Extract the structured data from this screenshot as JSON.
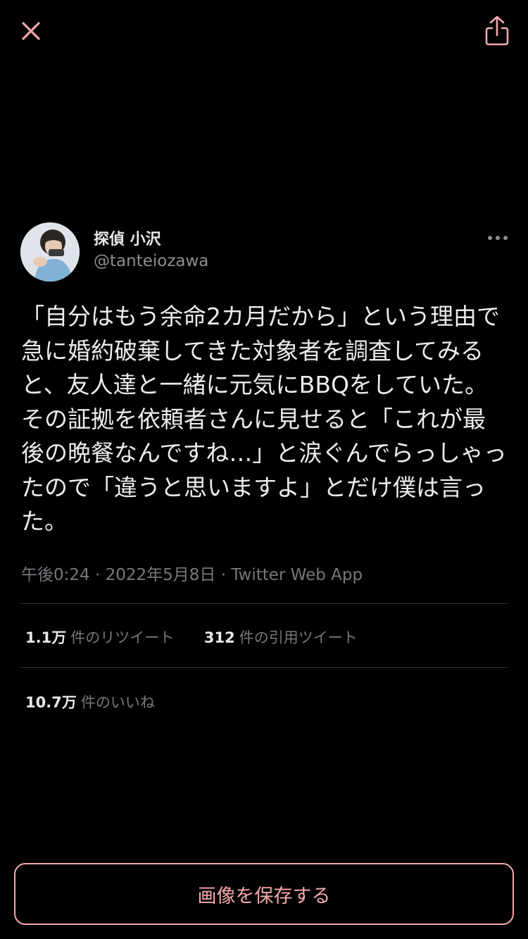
{
  "colors": {
    "background": "#000000",
    "accent": "#f4a7a9",
    "primary_text": "#ececec",
    "secondary_text": "#76787c",
    "divider": "#2e3033"
  },
  "toolbar": {
    "close_icon": "close-icon",
    "share_icon": "share-icon"
  },
  "tweet": {
    "display_name": "探偵 小沢",
    "handle": "@tanteiozawa",
    "more_icon": "more-horizontal-icon",
    "text": "「自分はもう余命2カ月だから」という理由で急に婚約破棄してきた対象者を調査してみると、友人達と一緒に元気にBBQをしていた。その証拠を依頼者さんに見せると「これが最後の晩餐なんですね…」と涙ぐんでらっしゃったので「違うと思いますよ」とだけ僕は言った。",
    "meta": "午後0:24 · 2022年5月8日 · Twitter Web App"
  },
  "stats": {
    "retweets": {
      "count": "1.1万",
      "label": "件のリツイート"
    },
    "quotes": {
      "count": "312",
      "label": "件の引用ツイート"
    },
    "likes": {
      "count": "10.7万",
      "label": "件のいいね"
    }
  },
  "actions": {
    "save_label": "画像を保存する"
  }
}
